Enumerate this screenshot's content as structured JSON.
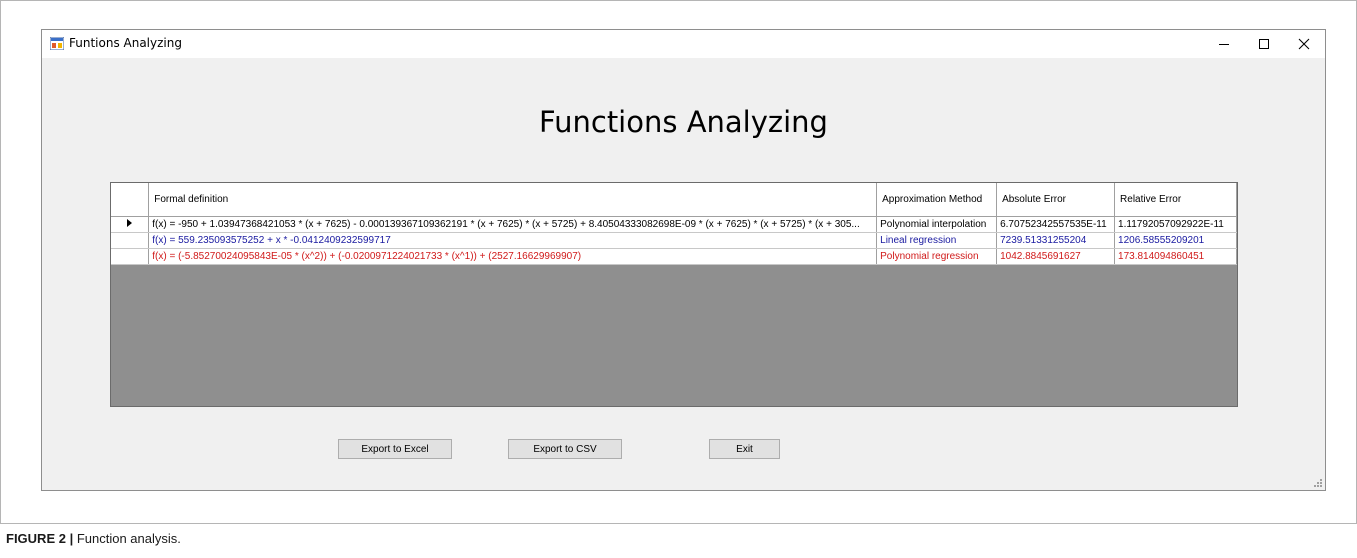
{
  "window": {
    "title": "Funtions Analyzing",
    "heading": "Functions Analyzing"
  },
  "grid": {
    "columns": [
      "Formal definition",
      "Approximation Method",
      "Absolute Error",
      "Relative Error"
    ],
    "rows": [
      {
        "selected": true,
        "color": "#000000",
        "formal_definition": "f(x) = -950 + 1.03947368421053 * (x + 7625) - 0.000139367109362191 * (x + 7625) * (x + 5725) + 8.40504333082698E-09 * (x + 7625) * (x + 5725) * (x + 305...",
        "method": "Polynomial interpolation",
        "absolute_error": "6.70752342557535E-11",
        "relative_error": "1.11792057092922E-11"
      },
      {
        "selected": false,
        "color": "#1a1aa0",
        "formal_definition": "f(x) = 559.235093575252 + x * -0.0412409232599717",
        "method": "Lineal regression",
        "absolute_error": "7239.51331255204",
        "relative_error": "1206.58555209201"
      },
      {
        "selected": false,
        "color": "#d01a1a",
        "formal_definition": "f(x) = (-5.85270024095843E-05 * (x^2)) + (-0.0200971224021733 * (x^1)) + (2527.16629969907)",
        "method": "Polynomial regression",
        "absolute_error": "1042.8845691627",
        "relative_error": "173.814094860451"
      }
    ]
  },
  "buttons": {
    "export_excel": "Export to Excel",
    "export_csv": "Export to CSV",
    "exit": "Exit"
  },
  "caption": {
    "label": "FIGURE 2 |",
    "text": " Function analysis."
  },
  "icons": {
    "app": "app-icon",
    "minimize": "minimize-icon",
    "maximize": "maximize-icon",
    "close": "close-icon",
    "row_selector": "row-selector-arrow-icon",
    "resize_grip": "resize-grip-icon"
  }
}
